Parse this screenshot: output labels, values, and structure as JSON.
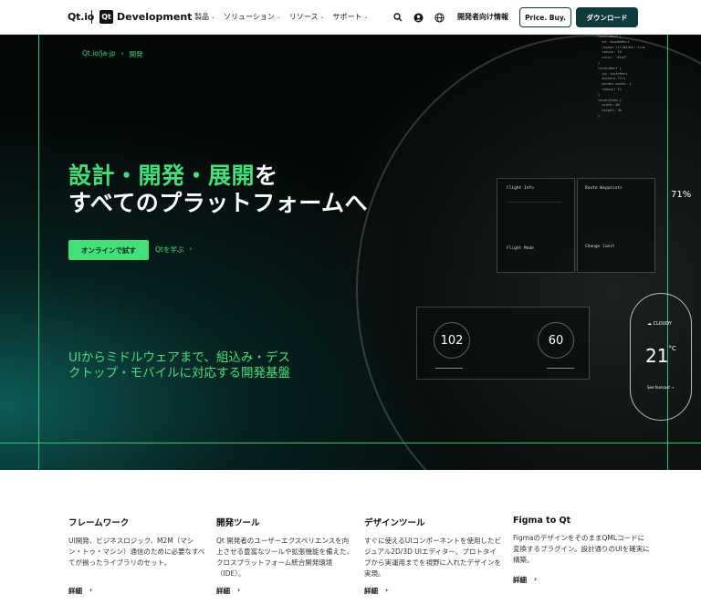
{
  "header": {
    "logo": "Qt.io",
    "logo_box": "Qt",
    "product": "Development",
    "nav": [
      {
        "label": "製品"
      },
      {
        "label": "ソリューション"
      },
      {
        "label": "リソース"
      },
      {
        "label": "サポート"
      }
    ],
    "icons": [
      "search-icon",
      "user-icon",
      "globe-icon"
    ],
    "developer_info": "開発者向け情報",
    "price_button": "Price. Buy.",
    "download_button": "ダウンロード"
  },
  "hero": {
    "breadcrumb": [
      "Qt.io/ja-jp",
      "開発"
    ],
    "title_green": "設計・開発・展開",
    "title_rest_line1": "を",
    "title_line2": "すべてのプラットフォームへ",
    "cta_primary": "オンラインで試す",
    "cta_secondary": "Qtを学ぶ",
    "subtitle": "UIからミドルウェアまで、組込み・デスクトップ・モバイルに対応する開発基盤"
  },
  "mockup": {
    "flight_info": "Flight Info",
    "route_waypoints": "Route Waypoints",
    "flight_mode": "Flight Mode",
    "change_limit": "Change limit",
    "percent": "71%",
    "gauge_left": "102",
    "gauge_right": "60",
    "weather_label": "CLOUDY",
    "temperature": "21",
    "temp_unit": "°C",
    "forecast_link": "See forecast",
    "code_lines": "localsRect {\n  id: shadowRect\n  layout.fillWidth: true\n  radius: 16\n  color: \"#1a2\"\n}\nlocalsRect {\n  id: innerRect\n  anchors.fill\n  border.width: 1\n  radius: 12\n}\nlocalsItem {\n  width: 80\n  height: 40\n}"
  },
  "features": [
    {
      "title": "フレームワーク",
      "text": "UI開発、ビジネスロジック、M2M（マシン・トゥ・マシン）通信のために必要なすべてが揃ったライブラリのセット。",
      "more": "詳細"
    },
    {
      "title": "開発ツール",
      "text": "Qt 開発者のユーザーエクスペリエンスを向上させる豊富なツールや拡張機能を備えた、クロスプラットフォーム統合開発環境（IDE）。",
      "more": "詳細"
    },
    {
      "title": "デザインツール",
      "text": "すぐに使えるUIコンポーネントを使用したビジュアル2D/3D UIエディター。プロトタイプから実運用までを視野に入れたデザインを実現。",
      "more": "詳細"
    },
    {
      "title": "Figma to Qt",
      "text": "FigmaのデザインをそのままQMLコードに変換するプラグイン。設計通りのUIを確実に構築。",
      "more": "詳細"
    }
  ],
  "colors": {
    "accent_green": "#41e079",
    "brand_dark": "#0e3b3e",
    "hero_bg": "#050808"
  }
}
